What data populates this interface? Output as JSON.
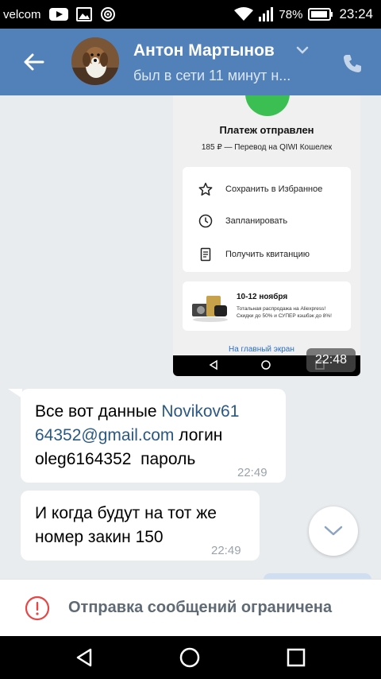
{
  "status_bar": {
    "carrier": "velcom",
    "battery": "78%",
    "time": "23:24"
  },
  "header": {
    "contact_name": "Антон Мартынов",
    "contact_status": "был в сети 11 минут н..."
  },
  "shared_screenshot": {
    "payment_title": "Платеж отправлен",
    "payment_subtitle": "185 ₽ — Перевод на QIWI Кошелек",
    "actions": [
      {
        "label": "Сохранить в Избранное",
        "icon": "star-icon"
      },
      {
        "label": "Запланировать",
        "icon": "clock-icon"
      },
      {
        "label": "Получить квитанцию",
        "icon": "receipt-icon"
      }
    ],
    "promo": {
      "title": "10-12 ноября",
      "line1": "Тотальная распродажа на Aliexpress!",
      "line2": "Скидки до 50% и СУПЕР кэшбэк до 8%!"
    },
    "home_link": "На главный экран",
    "time": "22:48"
  },
  "messages": [
    {
      "text_before": "Все вот данные ",
      "link": "Novikov61",
      "link_cont": "64352@gmail.com",
      "text_after_link": " логин",
      "line3": "oleg6164352  пароль",
      "time": "22:49"
    },
    {
      "line1": "И когда будут на тот же",
      "line2": "номер закин 150",
      "time": "22:49"
    }
  ],
  "restriction_notice": "Отправка сообщений ограничена",
  "colors": {
    "header": "#5181b8",
    "background": "#e9ecef",
    "link": "#2a5885",
    "warning_icon": "#e64646"
  }
}
